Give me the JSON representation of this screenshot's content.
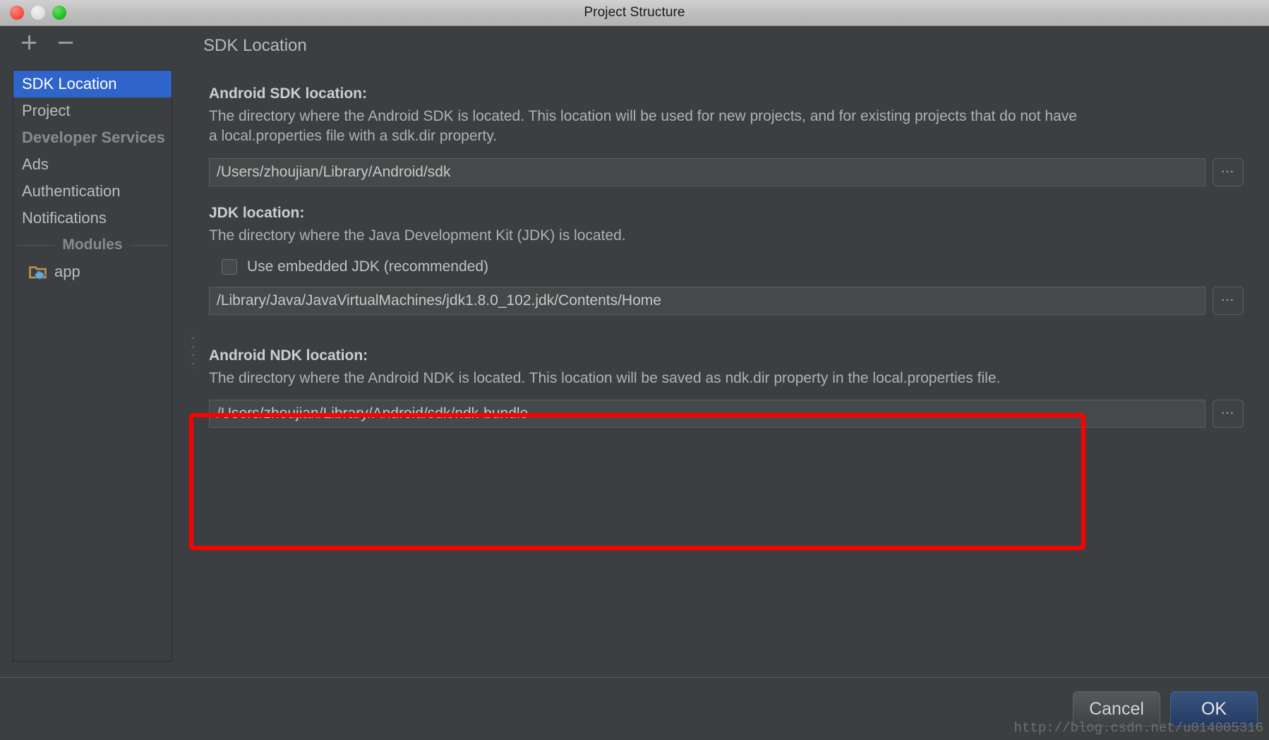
{
  "window": {
    "title": "Project Structure",
    "traffic_lights": [
      {
        "name": "close",
        "color": "#f5453c"
      },
      {
        "name": "minimize",
        "color": "#dcdcdc"
      },
      {
        "name": "zoom",
        "color": "#17bb21"
      }
    ]
  },
  "sidebar": {
    "toolbar": {
      "add_label": "+",
      "remove_label": "−"
    },
    "items": [
      {
        "label": "SDK Location",
        "type": "item",
        "selected": true
      },
      {
        "label": "Project",
        "type": "item",
        "selected": false
      },
      {
        "label": "Developer Services",
        "type": "group",
        "selected": false
      },
      {
        "label": "Ads",
        "type": "item",
        "selected": false
      },
      {
        "label": "Authentication",
        "type": "item",
        "selected": false
      },
      {
        "label": "Notifications",
        "type": "item",
        "selected": false
      }
    ],
    "separator_label": "Modules",
    "modules": [
      {
        "label": "app",
        "icon": "java-module-folder-icon"
      }
    ]
  },
  "main": {
    "title": "SDK Location",
    "sections": [
      {
        "id": "android-sdk",
        "heading": "Android SDK location:",
        "description": "The directory where the Android SDK is located. This location will be used for new projects, and for existing projects that do not have a local.properties file with a sdk.dir property.",
        "field_value": "/Users/zhoujian/Library/Android/sdk",
        "browse_label": "…"
      },
      {
        "id": "jdk",
        "heading": "JDK location:",
        "description": "The directory where the Java Development Kit (JDK) is located.",
        "checkbox": {
          "label": "Use embedded JDK (recommended)",
          "checked": false
        },
        "field_value": "/Library/Java/JavaVirtualMachines/jdk1.8.0_102.jdk/Contents/Home",
        "browse_label": "…"
      },
      {
        "id": "android-ndk",
        "heading": "Android NDK location:",
        "description": "The directory where the Android NDK is located. This location will be saved as ndk.dir property in the local.properties file.",
        "field_value": "/Users/zhoujian/Library/Android/sdk/ndk-bundle",
        "browse_label": "…",
        "highlighted": true,
        "highlight_color": "#fe0000"
      }
    ]
  },
  "footer": {
    "cancel_label": "Cancel",
    "ok_label": "OK"
  },
  "watermark": "http://blog.csdn.net/u014005316"
}
